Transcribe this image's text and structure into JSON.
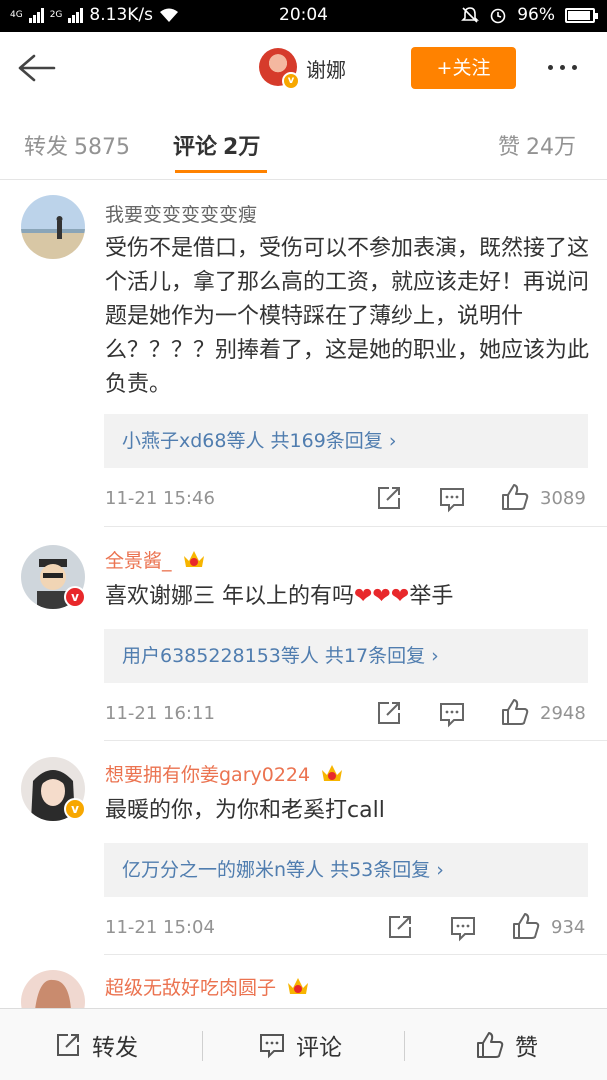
{
  "status_bar": {
    "network_1": "4G",
    "network_2": "2G",
    "speed": "8.13K/s",
    "time": "20:04",
    "battery": "96%"
  },
  "nav": {
    "user_name": "谢娜",
    "follow_label": "+关注"
  },
  "tabs": [
    {
      "label": "转发",
      "count": "5875"
    },
    {
      "label": "评论",
      "count": "2万"
    },
    {
      "label": "赞",
      "count": "24万"
    }
  ],
  "comments": [
    {
      "name": "我要变变变变变瘦",
      "text": "受伤不是借口，受伤可以不参加表演，既然接了这个活儿，拿了那么高的工资，就应该走好！再说问题是她作为一个模特踩在了薄纱上，说明什么？？？？别捧着了，这是她的职业，她应该为此负责。",
      "reply_summary": "小燕子xd68等人  共169条回复 ›",
      "time": "11-21 15:46",
      "likes": "3089"
    },
    {
      "name": "全景酱_",
      "text_before": "喜欢谢娜三 年以上的有吗",
      "hearts": "❤❤❤",
      "text_after": "举手",
      "reply_summary": "用户6385228153等人  共17条回复 ›",
      "time": "11-21 16:11",
      "likes": "2948"
    },
    {
      "name": "想要拥有你姜gary0224",
      "text": "最暖的你，为你和老奚打call",
      "reply_summary": "亿万分之一的娜米n等人  共53条回复 ›",
      "time": "11-21 15:04",
      "likes": "934"
    },
    {
      "name": "超级无敌好吃肉圆子"
    }
  ],
  "bottom_bar": {
    "repost": "转发",
    "comment": "评论",
    "like": "赞"
  },
  "colors": {
    "accent": "#ff8200",
    "link": "#507daf",
    "vip_name": "#eb7350",
    "verified_badge": "#f7a700"
  },
  "icons": [
    "back-arrow-icon",
    "more-dots-icon",
    "verified-icon",
    "crown-icon",
    "share-icon",
    "comment-icon",
    "thumbs-up-icon",
    "repost-icon"
  ]
}
